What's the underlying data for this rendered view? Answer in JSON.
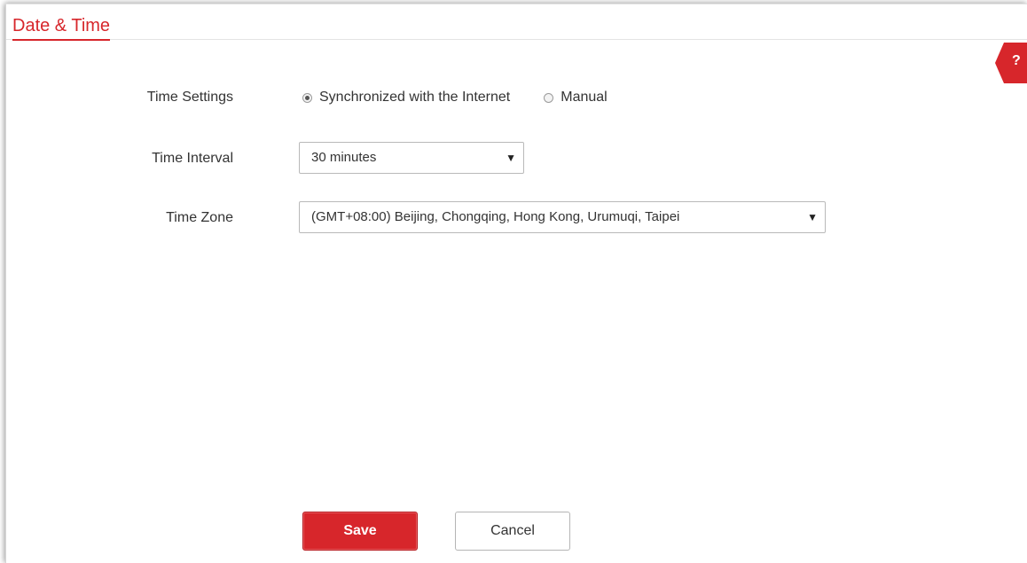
{
  "page": {
    "title": "Date & Time"
  },
  "help": {
    "icon": "help-icon",
    "glyph": "?",
    "color": "#d7262b"
  },
  "form": {
    "time_settings": {
      "label": "Time Settings",
      "options": [
        {
          "label": "Synchronized with the Internet",
          "checked": true
        },
        {
          "label": "Manual",
          "checked": false
        }
      ]
    },
    "time_interval": {
      "label": "Time Interval",
      "value": "30 minutes"
    },
    "time_zone": {
      "label": "Time Zone",
      "value": "(GMT+08:00) Beijing, Chongqing, Hong Kong, Urumuqi, Taipei"
    }
  },
  "buttons": {
    "save": "Save",
    "cancel": "Cancel"
  },
  "colors": {
    "accent": "#d7262b"
  }
}
